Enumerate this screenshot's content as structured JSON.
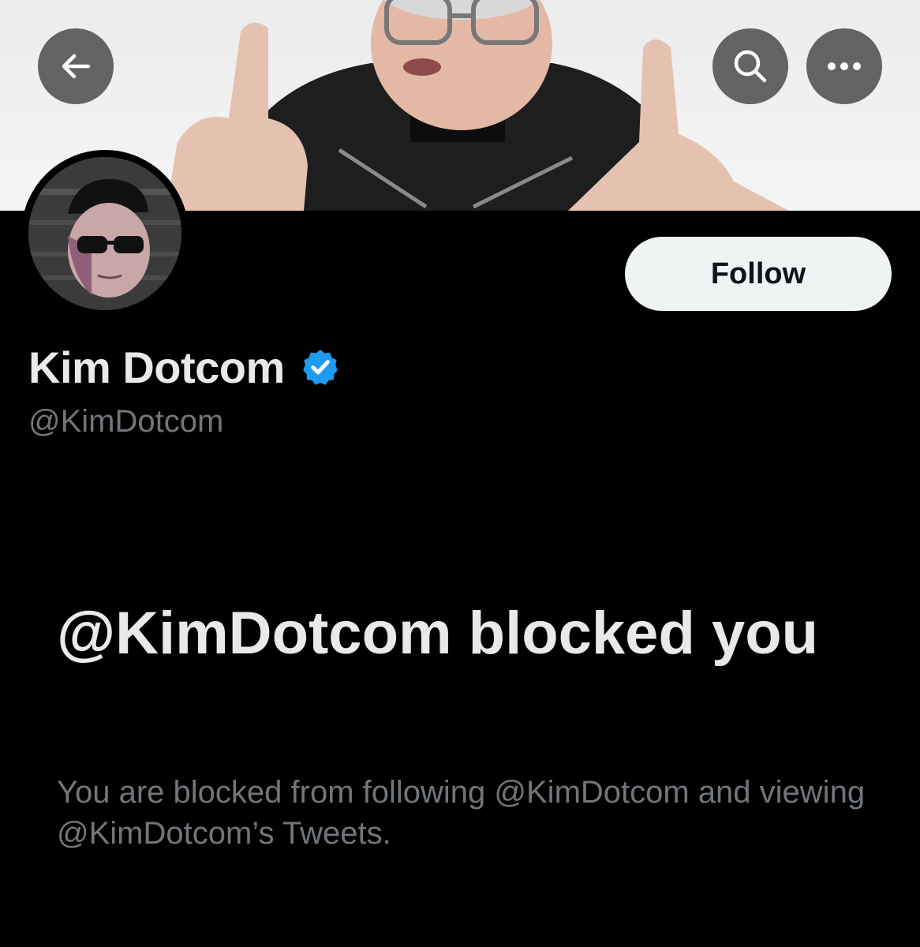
{
  "banner": {
    "background": "#eeeeee"
  },
  "header": {
    "back_icon": "arrow-left-icon",
    "search_icon": "search-icon",
    "more_icon": "more-horizontal-icon"
  },
  "profile": {
    "display_name": "Kim Dotcom",
    "handle": "@KimDotcom",
    "verified": true,
    "verified_color": "#1d9bf0",
    "follow_label": "Follow"
  },
  "blocked": {
    "title": "@KimDotcom blocked you",
    "description": "You are blocked from following @KimDotcom and viewing @KimDotcom’s Tweets."
  },
  "colors": {
    "background": "#000000",
    "primary_text": "#e7e9ea",
    "secondary_text": "#71767b",
    "follow_button_bg": "#eff3f4",
    "follow_button_text": "#0f1419"
  }
}
